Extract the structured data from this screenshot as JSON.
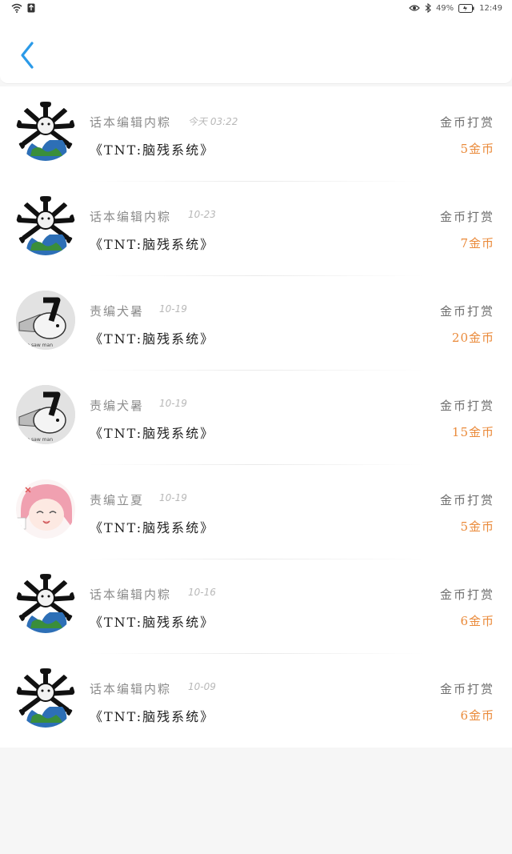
{
  "status_bar": {
    "battery_text": "49%",
    "time": "12:49"
  },
  "colors": {
    "accent": "#2b9ae8",
    "amount": "#ea8a3a"
  },
  "header": {
    "back_icon": "chevron-left-icon"
  },
  "rewards": [
    {
      "name": "话本编辑内粽",
      "date": "今天 03:22",
      "book": "《TNT:脑残系统》",
      "type": "金币打赏",
      "amount": "5金币",
      "avatar": "avatar-bone-globe"
    },
    {
      "name": "话本编辑内粽",
      "date": "10-23",
      "book": "《TNT:脑残系统》",
      "type": "金币打赏",
      "amount": "7金币",
      "avatar": "avatar-bone-globe"
    },
    {
      "name": "责编犬暑",
      "date": "10-19",
      "book": "《TNT:脑残系统》",
      "type": "金币打赏",
      "amount": "20金币",
      "avatar": "avatar-chainsaw-dog"
    },
    {
      "name": "责编犬暑",
      "date": "10-19",
      "book": "《TNT:脑残系统》",
      "type": "金币打赏",
      "amount": "15金币",
      "avatar": "avatar-chainsaw-dog"
    },
    {
      "name": "责编立夏",
      "date": "10-19",
      "book": "《TNT:脑残系统》",
      "type": "金币打赏",
      "amount": "5金币",
      "avatar": "avatar-anime-girl"
    },
    {
      "name": "话本编辑内粽",
      "date": "10-16",
      "book": "《TNT:脑残系统》",
      "type": "金币打赏",
      "amount": "6金币",
      "avatar": "avatar-bone-globe"
    },
    {
      "name": "话本编辑内粽",
      "date": "10-09",
      "book": "《TNT:脑残系统》",
      "type": "金币打赏",
      "amount": "6金币",
      "avatar": "avatar-bone-globe"
    }
  ]
}
